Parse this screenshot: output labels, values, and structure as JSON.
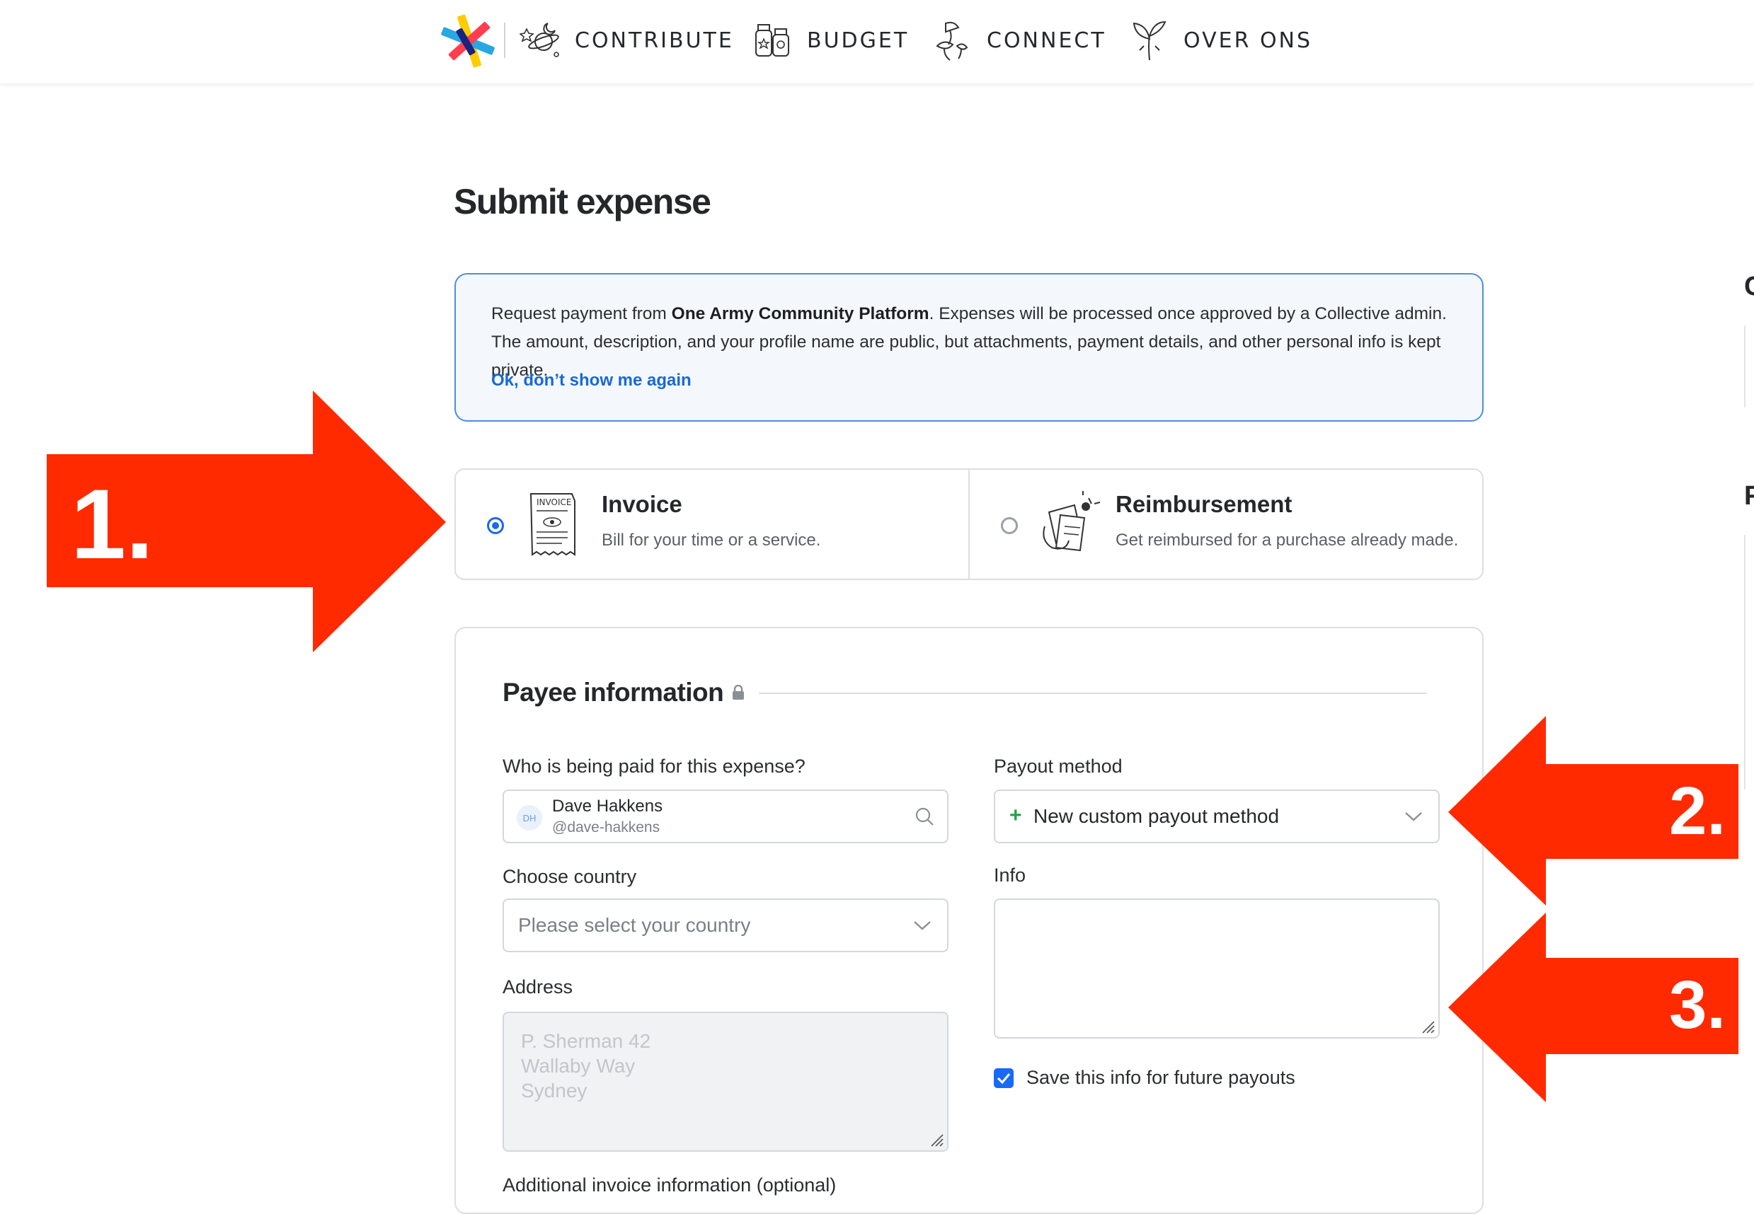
{
  "nav": {
    "items": [
      {
        "label": "CONTRIBUTE",
        "icon": "planets-icon"
      },
      {
        "label": "BUDGET",
        "icon": "jars-icon"
      },
      {
        "label": "CONNECT",
        "icon": "mushrooms-icon"
      },
      {
        "label": "OVER ONS",
        "icon": "plant-icon"
      }
    ],
    "logo_colors": [
      "#ff3e4f",
      "#ffcc00",
      "#29a7e1",
      "#1a237e"
    ]
  },
  "page": {
    "title": "Submit expense"
  },
  "info": {
    "text_prefix": "Request payment from ",
    "collective_name": "One Army Community Platform",
    "text_suffix": ". Expenses will be processed once approved by a Collective admin. The amount, description, and your profile name are public, but attachments, payment details, and other personal info is kept private.",
    "dismiss_link": "Ok, don’t show me again"
  },
  "expense_type": {
    "selected": "invoice",
    "invoice": {
      "title": "Invoice",
      "description": "Bill for your time or a service.",
      "illustration_text": "INVOICE"
    },
    "reimbursement": {
      "title": "Reimbursement",
      "description": "Get reimbursed for a purchase already made."
    }
  },
  "payee": {
    "section_title": "Payee information",
    "who_label": "Who is being paid for this expense?",
    "payee_name": "Dave Hakkens",
    "payee_handle": "@dave-hakkens",
    "payee_initials": "DH",
    "country_label": "Choose country",
    "country_placeholder": "Please select your country",
    "address_label": "Address",
    "address_placeholder_lines": [
      "P. Sherman 42",
      "Wallaby Way",
      "Sydney"
    ],
    "additional_label": "Additional invoice information (optional)",
    "payout_label": "Payout method",
    "payout_value": "New custom payout method",
    "info_label": "Info",
    "save_info_label": "Save this info for future payouts",
    "save_info_checked": true
  },
  "annotations": {
    "arrow_1": "1.",
    "arrow_2": "2.",
    "arrow_3": "3.",
    "arrow_color": "#ff2a00"
  },
  "side_panel_clipped": {
    "letter_1": "C",
    "letter_2": "F"
  },
  "colors": {
    "accent_blue": "#1869f5",
    "link_blue": "#1869d6",
    "info_border": "#4a8fe0"
  }
}
